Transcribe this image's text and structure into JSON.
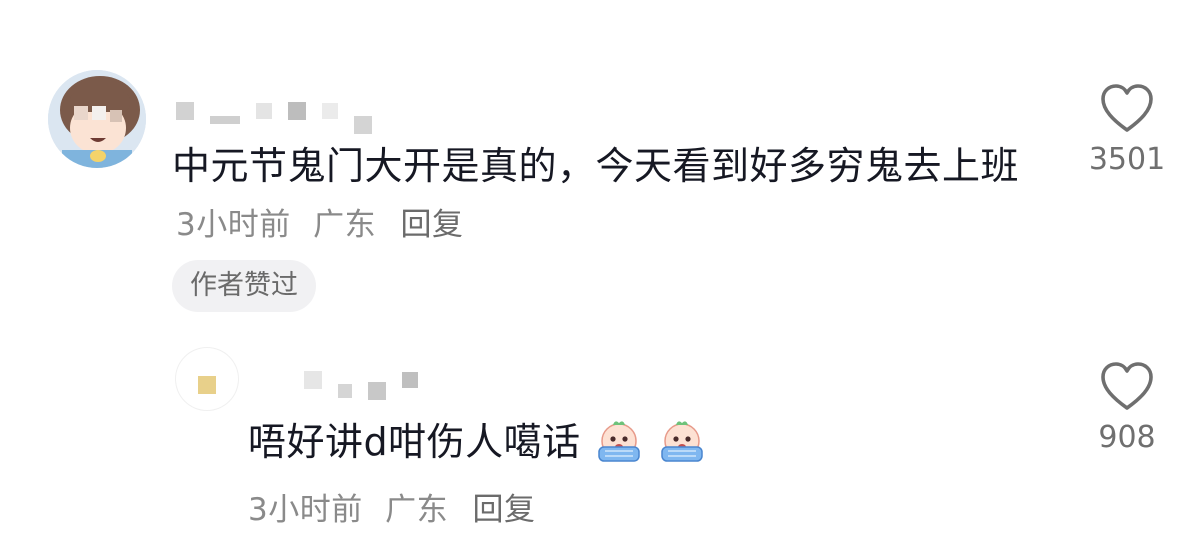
{
  "comments": [
    {
      "text": "中元节鬼门大开是真的，今天看到好多穷鬼去上班",
      "time": "3小时前",
      "location": "广东",
      "reply_label": "回复",
      "author_tag": "作者赞过",
      "like_count": "3501",
      "icons": {
        "like": "heart-outline-icon"
      }
    },
    {
      "text": "唔好讲d咁伤人噶话",
      "time": "3小时前",
      "location": "广东",
      "reply_label": "回复",
      "like_count": "908",
      "icons": {
        "emoji": "crying-emoji-icon",
        "like": "heart-outline-icon"
      }
    }
  ],
  "colors": {
    "text_primary": "#161823",
    "text_meta": "#8a8a8a",
    "tag_background": "#f1f1f3"
  }
}
